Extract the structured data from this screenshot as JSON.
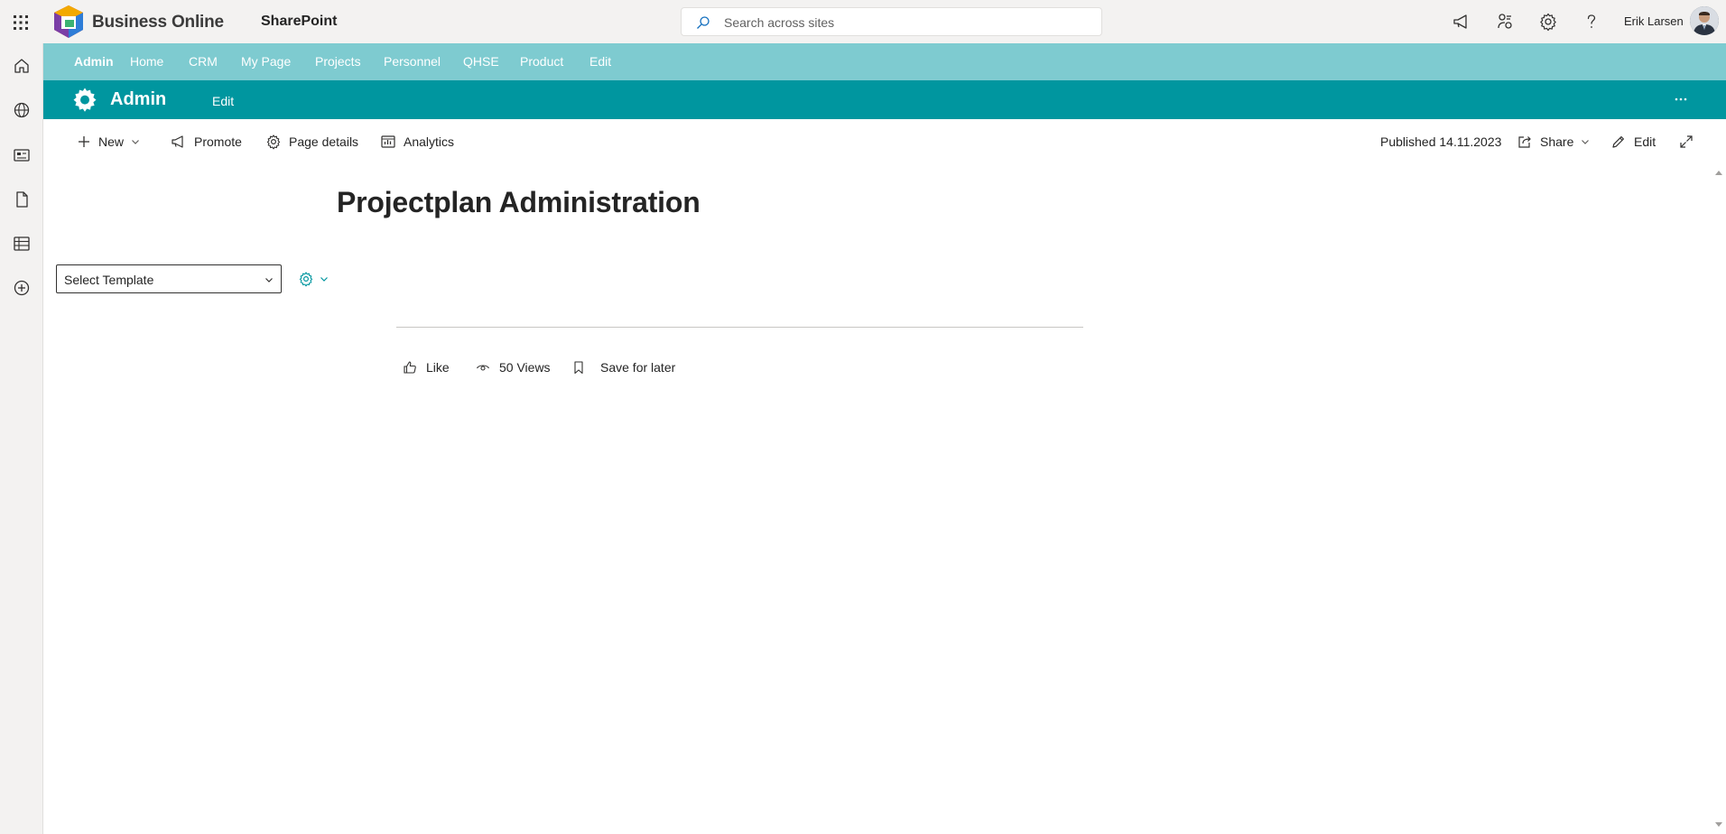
{
  "suite": {
    "brand": "Business Online",
    "app_name": "SharePoint",
    "search_placeholder": "Search across sites",
    "user_name": "Erik Larsen",
    "icons": [
      "waffle-icon",
      "megaphone-icon",
      "share-network-icon",
      "gear-icon",
      "help-icon"
    ]
  },
  "app_bar": {
    "icons": [
      "home-icon",
      "globe-icon",
      "news-icon",
      "document-icon",
      "list-icon",
      "add-icon"
    ]
  },
  "hub_nav": {
    "items": [
      {
        "label": "Admin",
        "active": true
      },
      {
        "label": "Home"
      },
      {
        "label": "CRM"
      },
      {
        "label": "My Page"
      },
      {
        "label": "Projects"
      },
      {
        "label": "Personnel"
      },
      {
        "label": "QHSE"
      },
      {
        "label": "Product"
      },
      {
        "label": "Edit"
      }
    ]
  },
  "site_header": {
    "title": "Admin",
    "edit_label": "Edit"
  },
  "command_bar": {
    "new_label": "New",
    "promote_label": "Promote",
    "page_details_label": "Page details",
    "analytics_label": "Analytics",
    "published_label": "Published 14.11.2023",
    "share_label": "Share",
    "edit_label": "Edit"
  },
  "page": {
    "title": "Projectplan Administration",
    "template_select": "Select Template",
    "like_label": "Like",
    "views_label": "50 Views",
    "save_label": "Save for later"
  },
  "colors": {
    "hub_nav_bg": "#7ecbd0",
    "site_header_bg": "#00969f",
    "suite_bg": "#f3f2f1"
  }
}
